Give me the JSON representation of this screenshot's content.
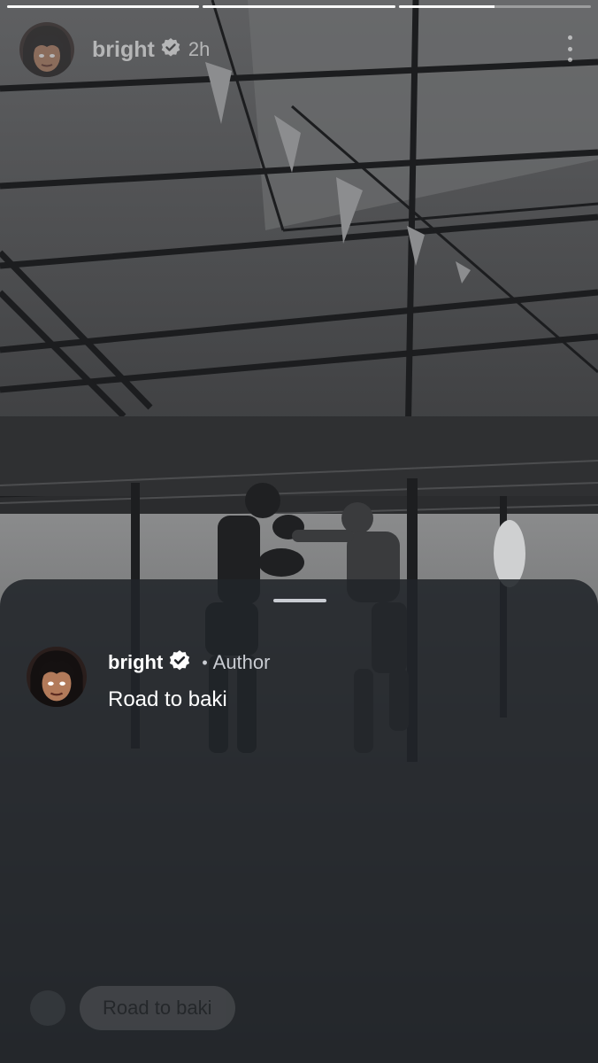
{
  "story": {
    "progress": [
      1,
      1,
      0.5
    ],
    "user": {
      "username": "bright",
      "verified": true,
      "time_ago": "2h"
    }
  },
  "comment_sheet": {
    "comment": {
      "username": "bright",
      "verified": true,
      "separator": "•",
      "role": "Author",
      "text": "Road to baki"
    }
  },
  "reply_bar": {
    "text": "Road to baki"
  },
  "icons": {
    "more": "more-vertical-icon",
    "verified": "verified-badge-icon"
  },
  "colors": {
    "sheet_bg": "#212429",
    "text_primary": "#ffffff",
    "text_secondary": "#c9ccd2"
  }
}
